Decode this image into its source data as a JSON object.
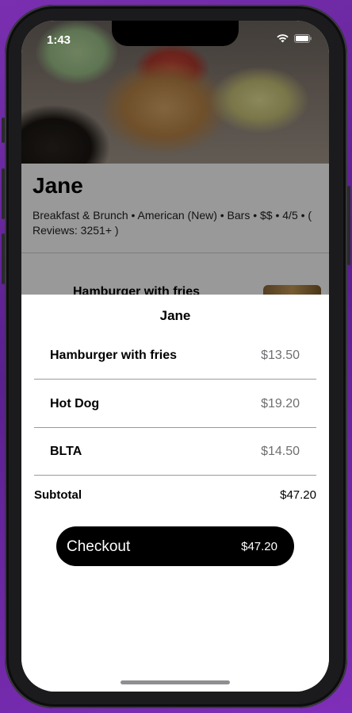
{
  "status": {
    "time": "1:43",
    "wifi_icon": "wifi-icon",
    "battery_icon": "battery-icon"
  },
  "restaurant": {
    "name": "Jane",
    "description": "Breakfast & Brunch • American (New) • Bars  • $$ • 4/5 • ( Reviews: 3251+ )",
    "partial_item": "Hamburger with fries"
  },
  "sheet": {
    "title": "Jane",
    "items": [
      {
        "name": "Hamburger with fries",
        "price": "$13.50"
      },
      {
        "name": "Hot Dog",
        "price": "$19.20"
      },
      {
        "name": "BLTA",
        "price": "$14.50"
      }
    ],
    "subtotal_label": "Subtotal",
    "subtotal_value": "$47.20",
    "checkout_label": "Checkout",
    "checkout_amount": "$47.20"
  },
  "colors": {
    "background": "#6a24a0",
    "button": "#000000",
    "price_text": "#6f6f73"
  }
}
